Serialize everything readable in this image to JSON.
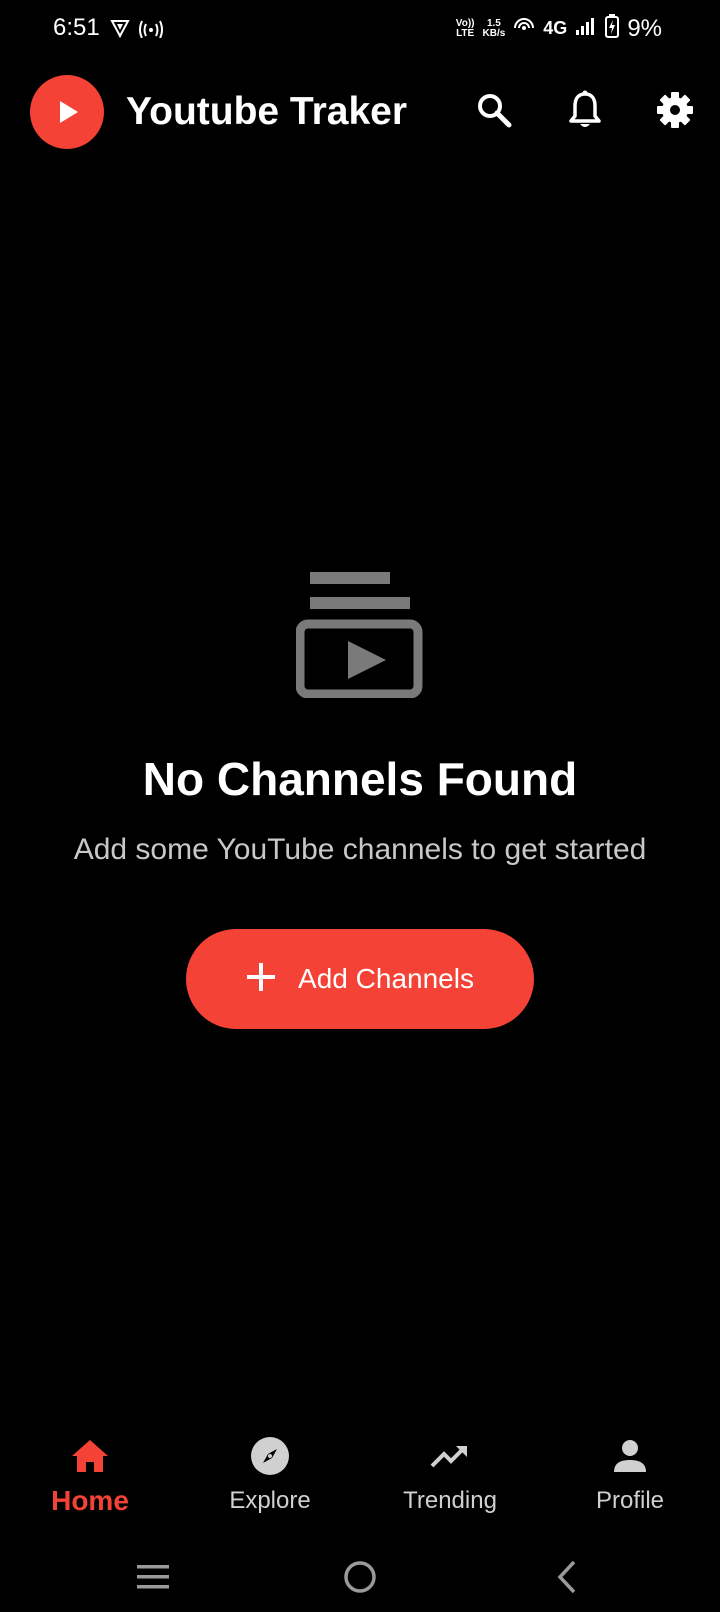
{
  "status_bar": {
    "time": "6:51",
    "volte_line1": "Vo))",
    "volte_line2": "LTE",
    "speed_value": "1.5",
    "speed_unit": "KB/s",
    "network": "4G",
    "battery_percent": "9%"
  },
  "app_bar": {
    "title": "Youtube Traker",
    "logo_icon": "play-logo-icon",
    "actions": [
      "search-icon",
      "bell-icon",
      "gear-icon"
    ]
  },
  "empty_state": {
    "icon": "subscriptions-icon",
    "title": "No Channels Found",
    "subtitle": "Add some YouTube channels to get started",
    "button_label": "Add Channels"
  },
  "bottom_nav": {
    "items": [
      {
        "label": "Home",
        "icon": "home-icon",
        "active": true
      },
      {
        "label": "Explore",
        "icon": "compass-icon",
        "active": false
      },
      {
        "label": "Trending",
        "icon": "trending-up-icon",
        "active": false
      },
      {
        "label": "Profile",
        "icon": "person-icon",
        "active": false
      }
    ]
  },
  "colors": {
    "accent": "#f44336",
    "background": "#000000",
    "muted_icon": "#7a7a7a"
  }
}
